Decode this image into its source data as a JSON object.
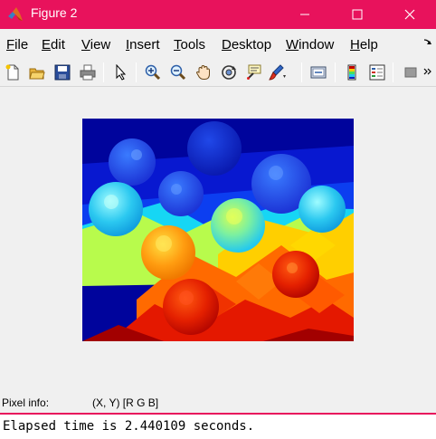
{
  "window": {
    "title": "Figure 2",
    "titlebar_color": "#e8125c",
    "controls": [
      "minimize-icon",
      "maximize-icon",
      "close-icon"
    ]
  },
  "menu": {
    "items": [
      {
        "label": "File",
        "mnemonic": "F"
      },
      {
        "label": "Edit",
        "mnemonic": "E"
      },
      {
        "label": "View",
        "mnemonic": "V"
      },
      {
        "label": "Insert",
        "mnemonic": "I"
      },
      {
        "label": "Tools",
        "mnemonic": "T"
      },
      {
        "label": "Desktop",
        "mnemonic": "D"
      },
      {
        "label": "Window",
        "mnemonic": "W"
      },
      {
        "label": "Help",
        "mnemonic": "H"
      }
    ],
    "dock_icon": "dock-arrow-icon"
  },
  "toolbar": {
    "icons": [
      "new-figure-icon",
      "open-file-icon",
      "save-icon",
      "print-icon",
      "edit-plot-arrow-icon",
      "zoom-in-icon",
      "zoom-out-icon",
      "pan-hand-icon",
      "rotate-3d-icon",
      "data-cursor-icon",
      "brush-icon",
      "link-plot-icon",
      "insert-colorbar-icon",
      "insert-legend-icon",
      "hide-plot-tools-icon",
      "show-plot-tools-icon"
    ]
  },
  "image": {
    "description_colormap": "jet",
    "colors": {
      "background_top": "#00049c",
      "blue_mid": "#0f2fdc",
      "cyan": "#18e8f0",
      "green": "#b8fb4c",
      "yellow": "#ffcf00",
      "orange": "#ff6a00",
      "red": "#e41800",
      "dark_red": "#a20000"
    }
  },
  "status": {
    "pixel_info_label": "Pixel info:",
    "pixel_info_value": "(X, Y)  [R G B]"
  },
  "console": {
    "text": "Elapsed time is 2.440109 seconds."
  }
}
